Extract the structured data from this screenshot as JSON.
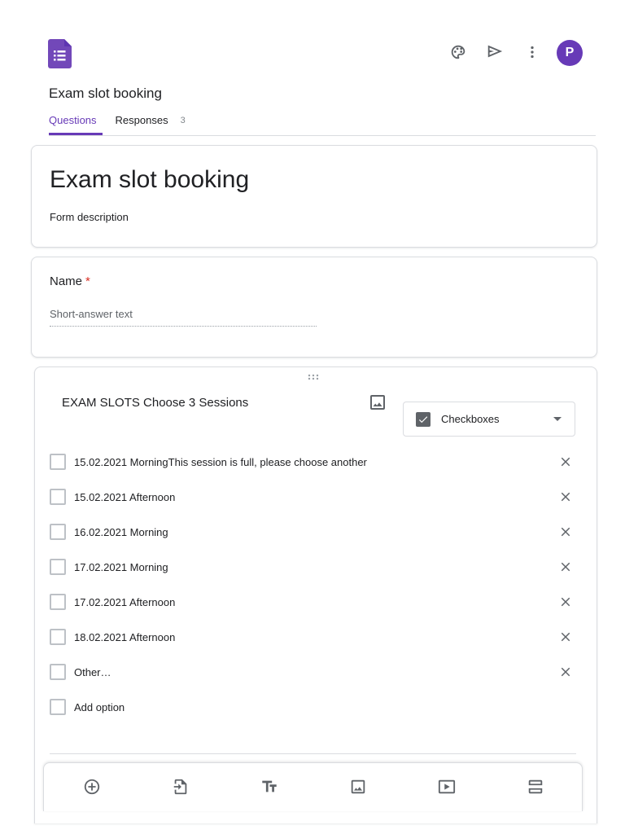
{
  "header": {
    "doc_title": "Exam slot booking",
    "avatar_letter": "P",
    "icons": [
      "palette-icon",
      "send-icon",
      "more-vert-icon"
    ]
  },
  "tabs": [
    {
      "label": "Questions",
      "active": true
    },
    {
      "label": "Responses",
      "count": "3"
    }
  ],
  "form": {
    "title": "Exam slot booking",
    "description": "Form description"
  },
  "questions": [
    {
      "title": "Name",
      "required_mark": "*",
      "answer_placeholder": "Short-answer text"
    },
    {
      "title": "EXAM SLOTS Choose 3 Sessions",
      "type": "Checkboxes",
      "options": [
        "15.02.2021 MorningThis session is full, please choose another",
        "15.02.2021 Afternoon",
        "16.02.2021 Morning",
        "17.02.2021 Morning",
        "17.02.2021 Afternoon",
        "18.02.2021 Afternoon",
        "Other…"
      ],
      "add_option": "Add option"
    }
  ],
  "toolbar": [
    "add-question-icon",
    "import-questions-icon",
    "add-title-icon",
    "add-image-icon",
    "add-video-icon",
    "add-section-icon"
  ],
  "colors": {
    "accent": "#673ab7",
    "required": "#d93025",
    "border": "#dadce0"
  }
}
